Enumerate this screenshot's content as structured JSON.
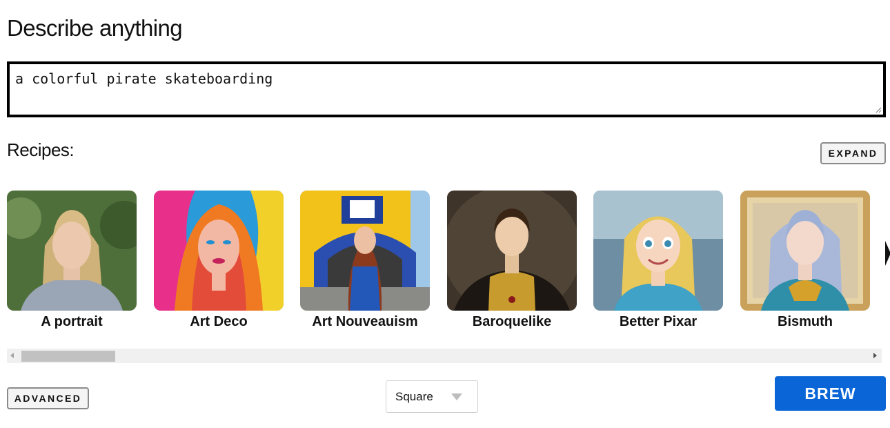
{
  "header": {
    "title": "Describe anything"
  },
  "prompt": {
    "value": "a colorful pirate skateboarding"
  },
  "recipes": {
    "label": "Recipes:",
    "expand_label": "EXPAND",
    "items": [
      {
        "label": "A portrait"
      },
      {
        "label": "Art Deco"
      },
      {
        "label": "Art Nouveauism"
      },
      {
        "label": "Baroquelike"
      },
      {
        "label": "Better Pixar"
      },
      {
        "label": "Bismuth"
      }
    ]
  },
  "footer": {
    "advanced_label": "ADVANCED",
    "aspect": {
      "selected": "Square"
    },
    "brew_label": "BREW"
  },
  "colors": {
    "brew_button": "#0a66d6",
    "prompt_border": "#000000",
    "scroll_track": "#f0f0f0",
    "scroll_thumb": "#c1c1c1"
  },
  "icons": [
    "resize-grip-icon",
    "carousel-next-icon",
    "scroll-left-arrow-icon",
    "scroll-right-arrow-icon",
    "chevron-down-icon"
  ]
}
